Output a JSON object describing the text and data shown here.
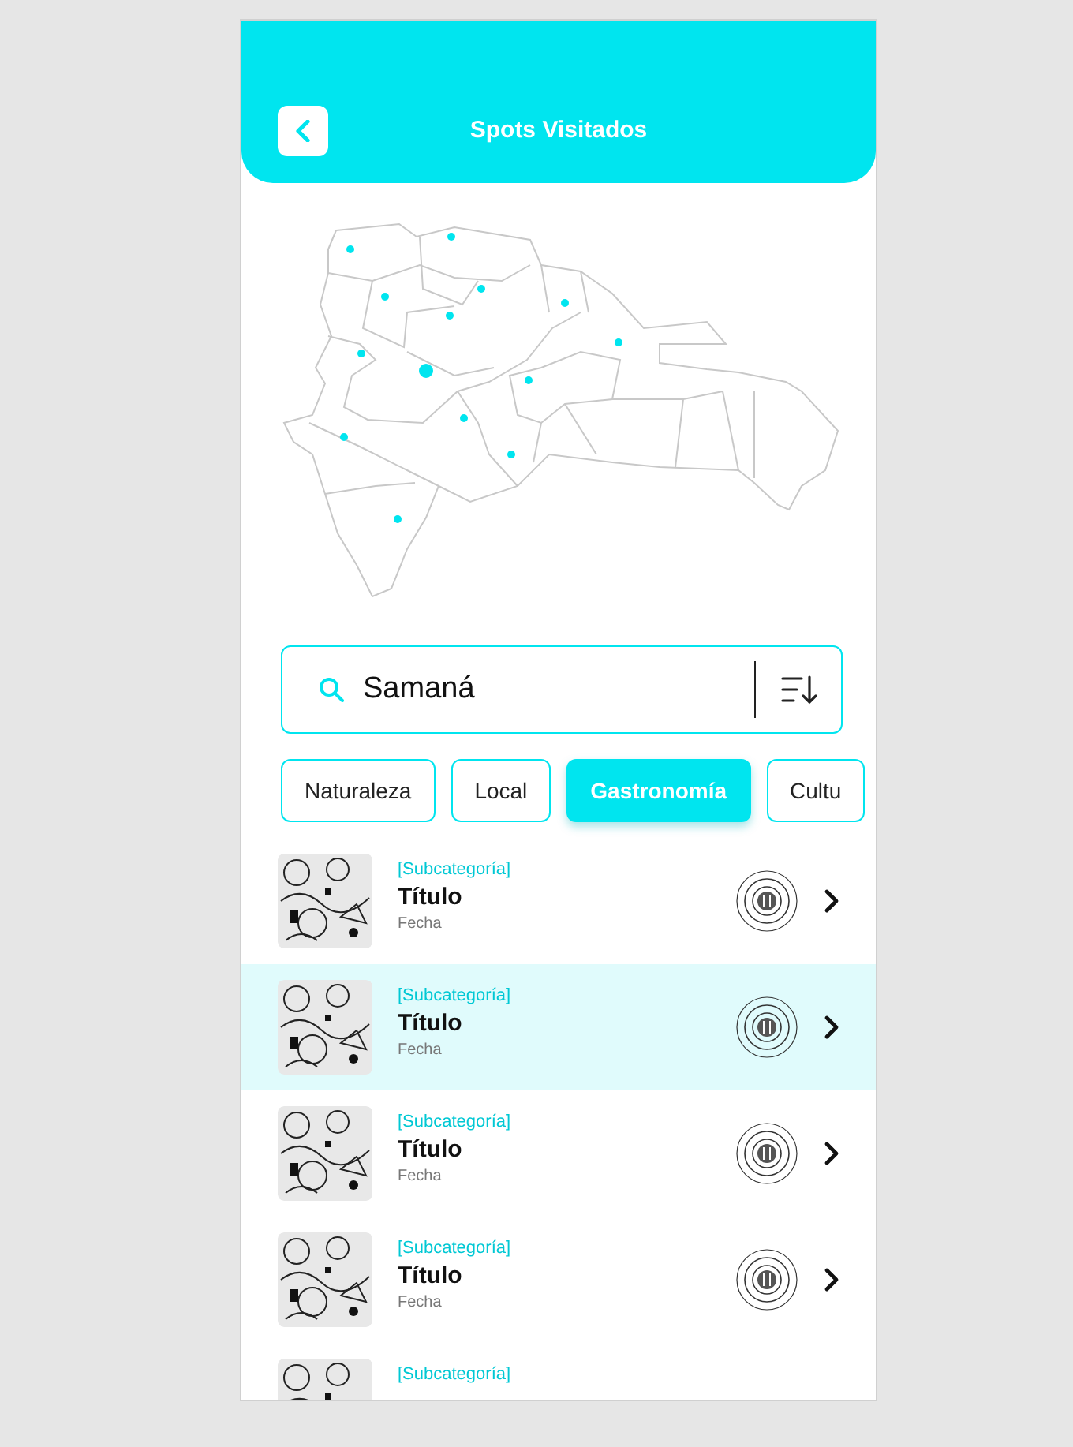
{
  "header": {
    "title": "Spots Visitados"
  },
  "search": {
    "value": "Samaná"
  },
  "filters": [
    {
      "label": "Naturaleza",
      "selected": false
    },
    {
      "label": "Local",
      "selected": false
    },
    {
      "label": "Gastronomía",
      "selected": true
    },
    {
      "label": "Cultu",
      "selected": false
    }
  ],
  "spots": [
    {
      "subcategory": "[Subcategoría]",
      "title": "Título",
      "date": "Fecha",
      "selected": false
    },
    {
      "subcategory": "[Subcategoría]",
      "title": "Título",
      "date": "Fecha",
      "selected": true
    },
    {
      "subcategory": "[Subcategoría]",
      "title": "Título",
      "date": "Fecha",
      "selected": false
    },
    {
      "subcategory": "[Subcategoría]",
      "title": "Título",
      "date": "Fecha",
      "selected": false
    },
    {
      "subcategory": "[Subcategoría]",
      "selected": false
    }
  ]
}
